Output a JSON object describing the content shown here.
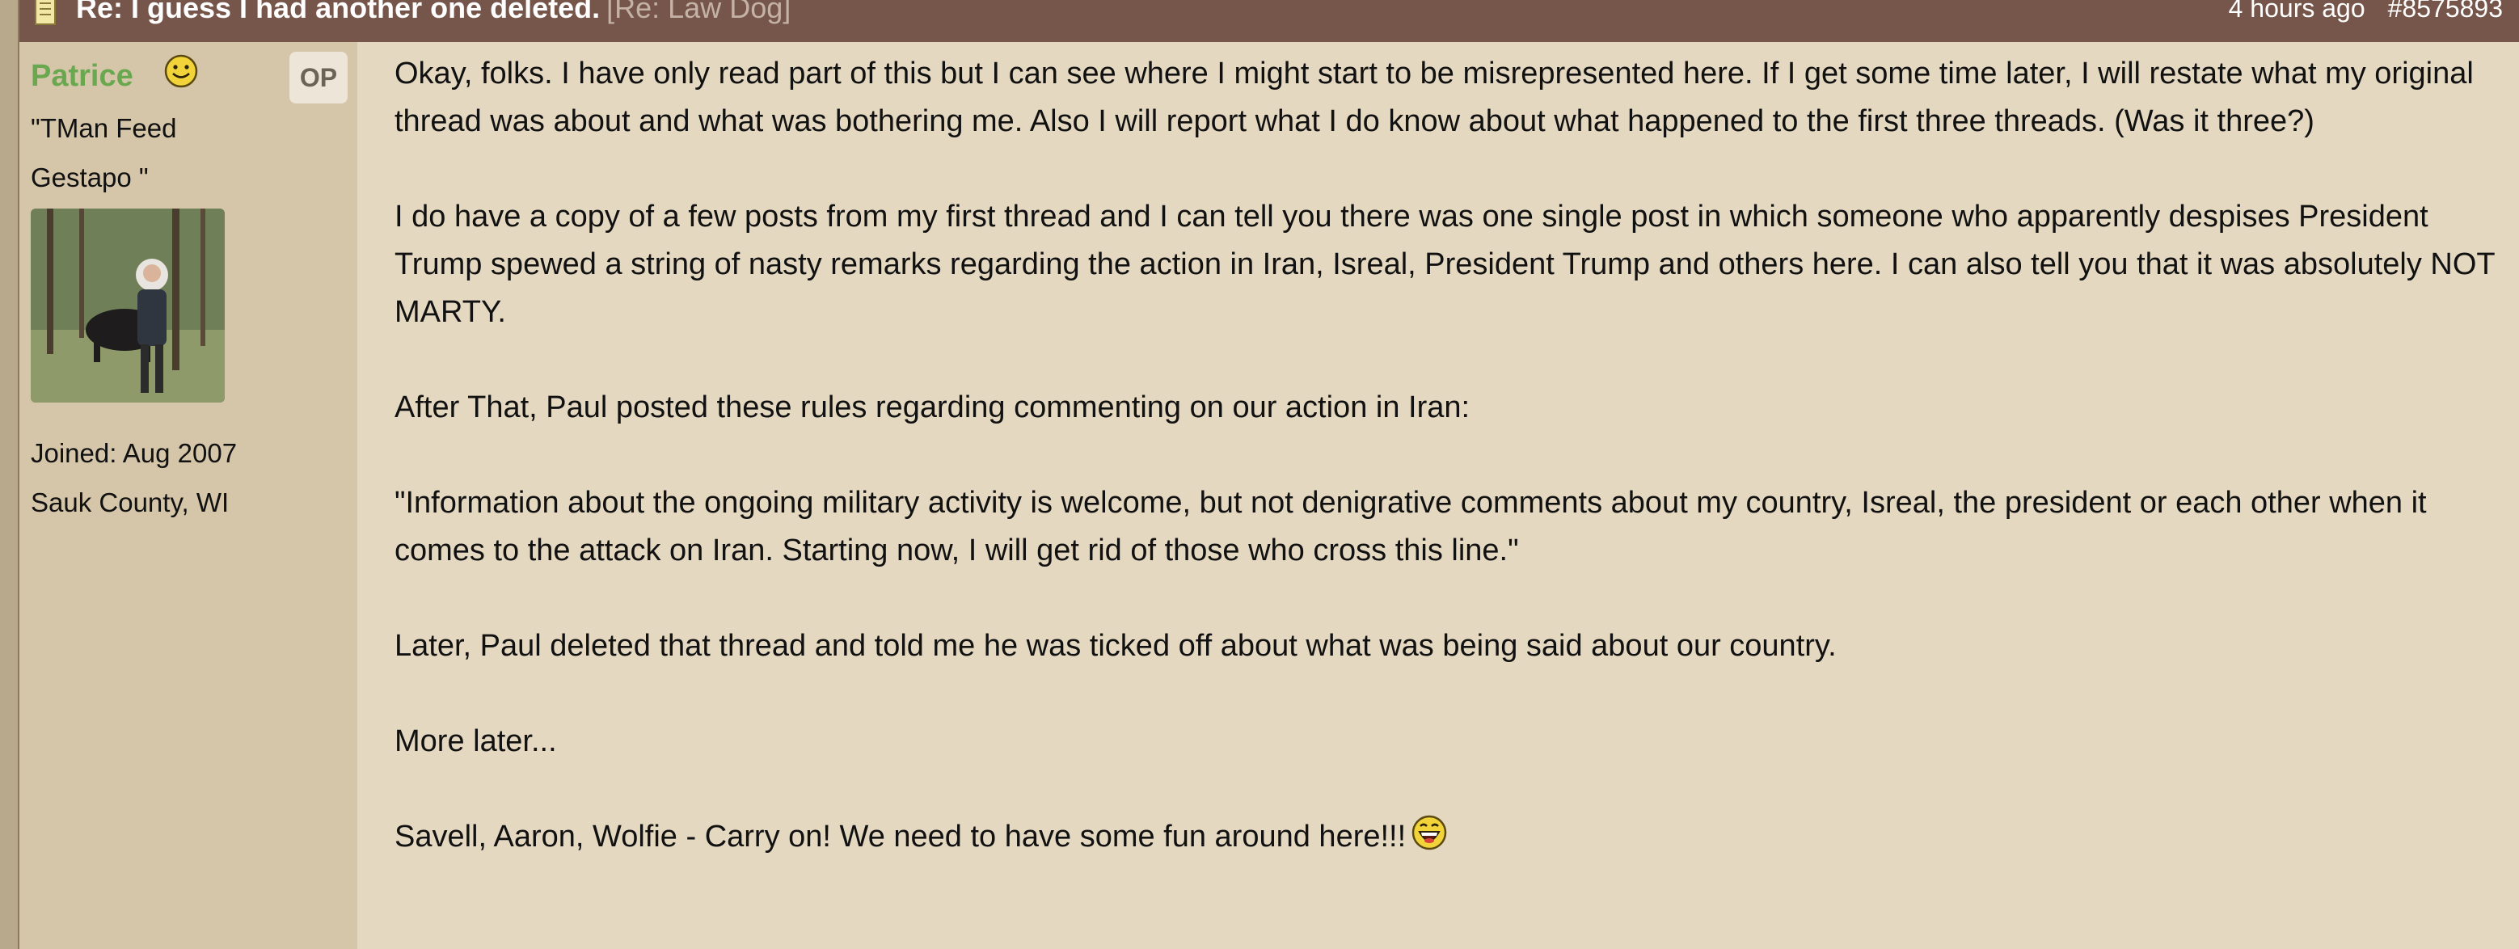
{
  "header": {
    "subject": "Re: I guess I had another one deleted.",
    "reply_ref": "[Re: Law Dog]",
    "time": "4 hours ago",
    "post_number": "#8575893",
    "icon": "post-document-icon"
  },
  "author": {
    "name": "Patrice",
    "status_icon": "smile-icon",
    "badge": "OP",
    "title_line1": "\"TMan Feed",
    "title_line2": "Gestapo \"",
    "avatar_icon": "avatar-photo",
    "joined": "Joined: Aug 2007",
    "location": "Sauk County, WI"
  },
  "post": {
    "paragraphs": [
      "Okay, folks. I have only read part of this but I can see where I might start to be misrepresented here. If I get some time later, I will restate what my original thread was about and what was bothering me. Also I will report what I do know about what happened to the first three threads. (Was it three?)",
      "I do have a copy of a few posts from my first thread and I can tell you there was one single post in which someone who apparently despises President Trump spewed a string of nasty remarks regarding the action in Iran, Isreal, President Trump and others here. I can also tell you that it was absolutely NOT MARTY.",
      "After That, Paul posted these rules regarding commenting on our action in Iran:",
      "\"Information about the ongoing military activity is welcome, but not denigrative comments about my country, Isreal, the president or each other when it comes to the attack on Iran. Starting now, I will get rid of those who cross this line.\"",
      "Later, Paul deleted that thread and told me he was ticked off about what was being said about our country.",
      "More later...",
      "Savell, Aaron, Wolfie - Carry on! We need to have some fun around here!!!"
    ],
    "closing_emoticon": "laugh-icon"
  },
  "colors": {
    "header_bg": "#76564a",
    "sidebar_bg": "#d5c6aa",
    "body_bg": "#e4d8c1",
    "username": "#6aa84f"
  }
}
